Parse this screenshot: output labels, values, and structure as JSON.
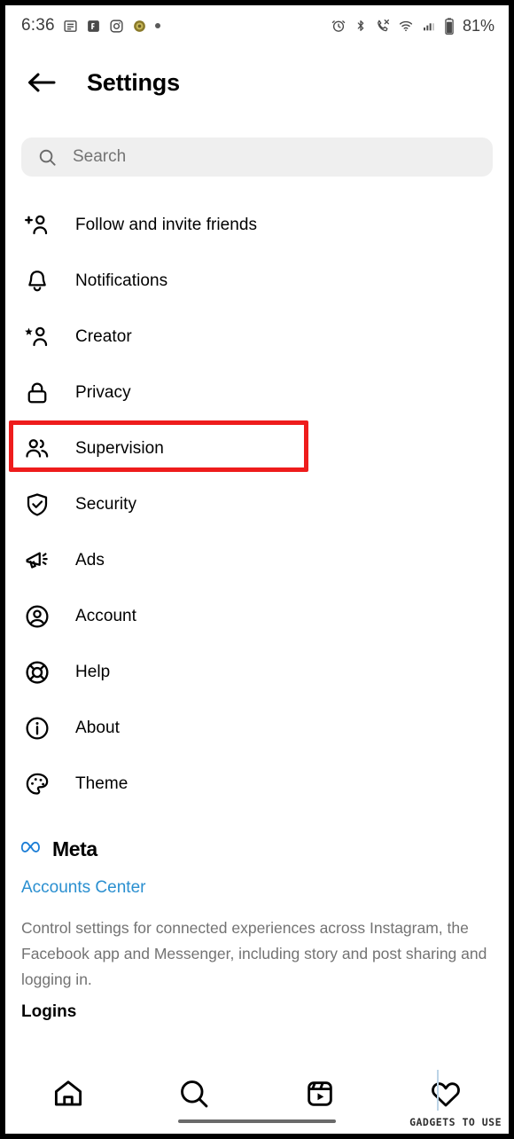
{
  "statusbar": {
    "time": "6:36",
    "left_icons": [
      "news-app-icon",
      "facebook-messenger-icon",
      "instagram-icon",
      "coin-app-icon",
      "more-dot-icon"
    ],
    "right_icons": [
      "alarm-icon",
      "bluetooth-icon",
      "call-mute-icon",
      "wifi-icon",
      "cellular-signal-icon",
      "battery-icon"
    ],
    "battery_percent": "81%"
  },
  "header": {
    "back_label": "back-arrow",
    "title": "Settings"
  },
  "search": {
    "placeholder": "Search",
    "value": ""
  },
  "settings_list": [
    {
      "label": "Follow and invite friends",
      "icon": "person-add-icon"
    },
    {
      "label": "Notifications",
      "icon": "bell-icon"
    },
    {
      "label": "Creator",
      "icon": "person-star-icon"
    },
    {
      "label": "Privacy",
      "icon": "lock-icon"
    },
    {
      "label": "Supervision",
      "icon": "people-icon",
      "highlighted": true
    },
    {
      "label": "Security",
      "icon": "shield-check-icon"
    },
    {
      "label": "Ads",
      "icon": "megaphone-icon"
    },
    {
      "label": "Account",
      "icon": "account-circle-icon"
    },
    {
      "label": "Help",
      "icon": "life-ring-icon"
    },
    {
      "label": "About",
      "icon": "info-circle-icon"
    },
    {
      "label": "Theme",
      "icon": "palette-icon"
    }
  ],
  "meta": {
    "brand": "Meta",
    "accounts_center_link": "Accounts Center",
    "description": "Control settings for connected experiences across Instagram, the Facebook app and Messenger, including story and post sharing and logging in.",
    "logins_heading": "Logins"
  },
  "bottom_nav": [
    {
      "icon": "home-icon",
      "name": "nav-home"
    },
    {
      "icon": "search-icon",
      "name": "nav-search"
    },
    {
      "icon": "reels-icon",
      "name": "nav-reels"
    },
    {
      "icon": "heart-icon",
      "name": "nav-activity"
    }
  ],
  "watermark": {
    "text": "GADGETS TO USE"
  },
  "colors": {
    "link_blue": "#2a8fd0",
    "meta_logo_blue": "#1c7ed6",
    "highlight_red": "#ee1c1c",
    "search_bg": "#efefef",
    "muted_text": "#737373"
  }
}
